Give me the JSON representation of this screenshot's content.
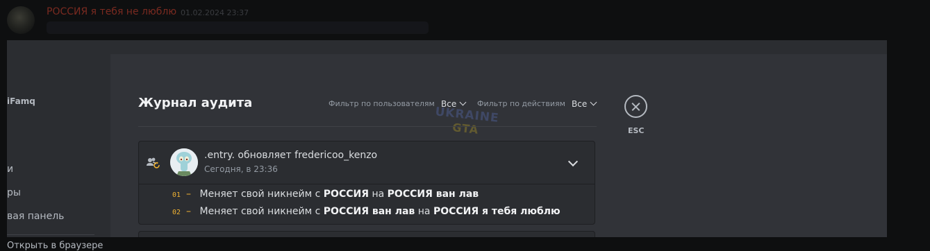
{
  "background_message": {
    "author": "РОССИЯ я тебя не люблю",
    "timestamp": "01.02.2024 23:37"
  },
  "sidebar": {
    "heading": "iFamq",
    "items": [
      {
        "label": "и"
      },
      {
        "label": "ры"
      },
      {
        "label": "вая панель"
      }
    ],
    "below_label": "Открыть в браузере"
  },
  "audit_log": {
    "title": "Журнал аудита",
    "filter_user_label": "Фильтр по пользователям",
    "filter_user_value": "Все",
    "filter_action_label": "Фильтр по действиям",
    "filter_action_value": "Все",
    "close_label": "ESC",
    "watermark": {
      "line1": "UKRAINE",
      "line2": "GTA"
    },
    "entry": {
      "actor": ".entry.",
      "verb": "обновляет",
      "target": "fredericoo_kenzo",
      "time": "Сегодня, в 23:36",
      "changes": [
        {
          "num": "01",
          "text_before": "Меняет свой никнейм с",
          "from": "РОССИЯ",
          "text_mid": "на",
          "to": "РОССИЯ ван лав"
        },
        {
          "num": "02",
          "text_before": "Меняет свой никнейм с",
          "from": "РОССИЯ ван лав",
          "text_mid": "на",
          "to": "РОССИЯ я тебя люблю"
        }
      ]
    }
  },
  "colors": {
    "modal_bg": "#313338",
    "sidebar_bg": "#2b2d31",
    "accent_orange": "#f0b232",
    "author_red": "#7a2a20"
  }
}
